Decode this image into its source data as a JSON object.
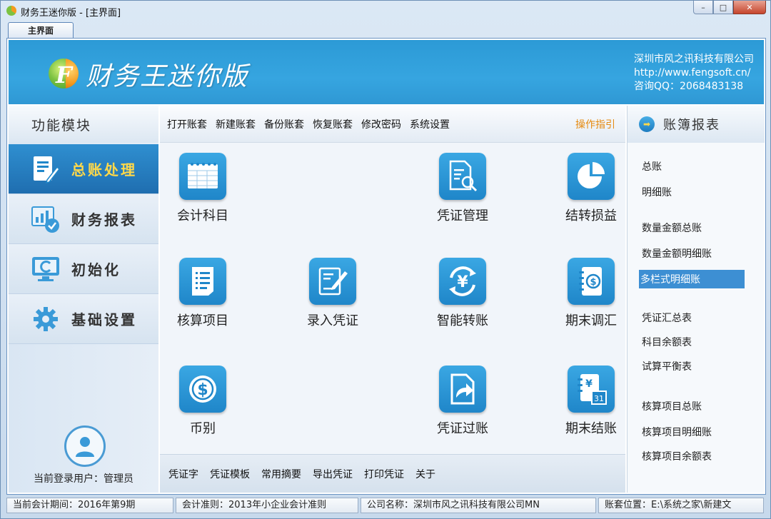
{
  "window": {
    "title": "财务王迷你版 - [主界面]",
    "min": "–",
    "max": "□",
    "close": "✕"
  },
  "tab": {
    "label": "主界面"
  },
  "banner": {
    "logo_letter": "F",
    "app_name": "财务王迷你版",
    "company": "深圳市风之讯科技有限公司",
    "url": "http://www.fengsoft.cn/",
    "qq": "咨询QQ：2068483138"
  },
  "left": {
    "header": "功能模块",
    "modules": [
      {
        "label": "总账处理",
        "icon": "ledger-edit-icon"
      },
      {
        "label": "财务报表",
        "icon": "report-check-icon"
      },
      {
        "label": "初始化",
        "icon": "monitor-refresh-icon"
      },
      {
        "label": "基础设置",
        "icon": "gear-icon"
      }
    ],
    "user": "当前登录用户：管理员"
  },
  "toolbar": {
    "items": [
      "打开账套",
      "新建账套",
      "备份账套",
      "恢复账套",
      "修改密码",
      "系统设置"
    ],
    "guide": "操作指引"
  },
  "tiles": [
    {
      "label": "会计科目",
      "icon": "spreadsheet-icon"
    },
    {
      "label": "凭证管理",
      "icon": "document-search-icon"
    },
    {
      "label": "结转损益",
      "icon": "pie-chart-icon"
    },
    {
      "label": "核算项目",
      "icon": "list-document-icon"
    },
    {
      "label": "录入凭证",
      "icon": "pen-document-icon"
    },
    {
      "label": "智能转账",
      "icon": "yen-cycle-icon"
    },
    {
      "label": "期末调汇",
      "icon": "dollar-notebook-icon"
    },
    {
      "label": "币别",
      "icon": "dollar-coin-icon"
    },
    {
      "label": "凭证过账",
      "icon": "post-arrow-icon"
    },
    {
      "label": "期末结账",
      "icon": "calendar-yen-icon"
    }
  ],
  "calendar_day": "31",
  "bottombar": {
    "items": [
      "凭证字",
      "凭证模板",
      "常用摘要",
      "导出凭证",
      "打印凭证",
      "关于"
    ]
  },
  "right": {
    "header": "账簿报表",
    "links": [
      "总账",
      "明细账",
      "数量金额总账",
      "数量金额明细账",
      "多栏式明细账",
      "凭证汇总表",
      "科目余额表",
      "试算平衡表",
      "核算项目总账",
      "核算项目明细账",
      "核算项目余额表"
    ],
    "selected_index": 4
  },
  "status": {
    "period": "当前会计期间：2016年第9期",
    "standard": "会计准则：2013年小企业会计准则",
    "company": "公司名称：深圳市风之讯科技有限公司MN",
    "location": "账套位置：E:\\系统之家\\新建文"
  },
  "colors": {
    "accent": "#2c9ad6",
    "active_module": "#1f6eb0",
    "highlight_text": "#ffd84a",
    "guide": "#e58a10"
  }
}
